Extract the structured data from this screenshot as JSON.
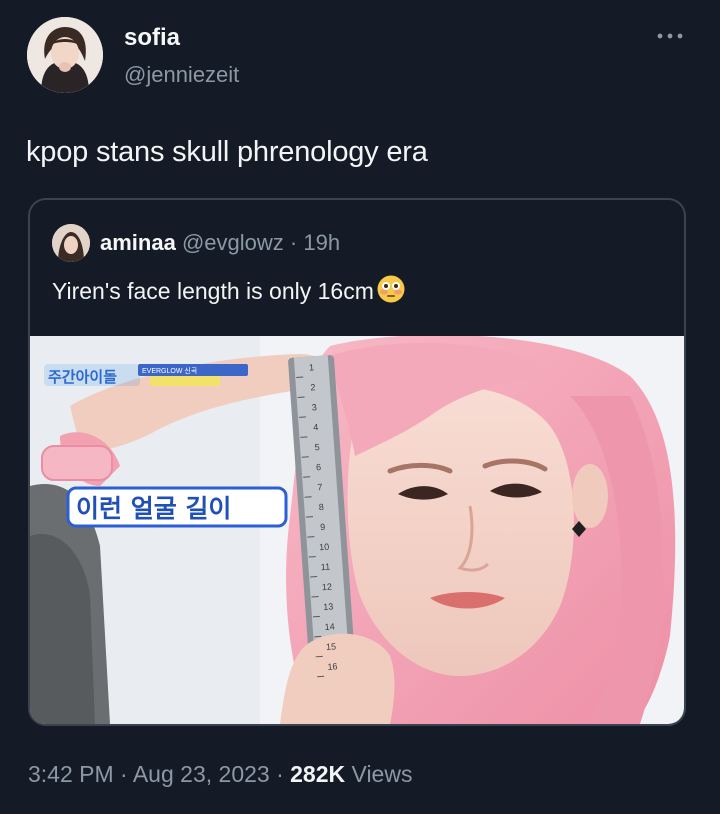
{
  "tweet": {
    "author_name": "sofia",
    "author_handle": "@jenniezeit",
    "text": "kpop stans skull phrenology era",
    "time": "3:42 PM",
    "date": "Aug 23, 2023",
    "views_count": "282K",
    "views_label": "Views",
    "separator": "·"
  },
  "quote": {
    "name": "aminaa",
    "handle": "@evglowz",
    "separator": "·",
    "time": "19h",
    "text": "Yiren's face length is only 16cm",
    "emoji": "flushed-face-emoji",
    "media": {
      "show_logo_text": "주간아이돌",
      "banner_text": "EVERGLOW 신곡",
      "caption": "이런 얼굴 길이",
      "tape_numbers": [
        "1",
        "2",
        "3",
        "4",
        "5",
        "6",
        "7",
        "8",
        "9",
        "10",
        "11",
        "12",
        "13",
        "14",
        "15",
        "16"
      ]
    }
  },
  "colors": {
    "background": "#151b26",
    "text_primary": "#f2f4f5",
    "text_secondary": "#8b98a5",
    "card_border": "#3a4450",
    "hair": "#f3a3b5"
  },
  "icons": {
    "more": "more-horizontal-icon"
  }
}
